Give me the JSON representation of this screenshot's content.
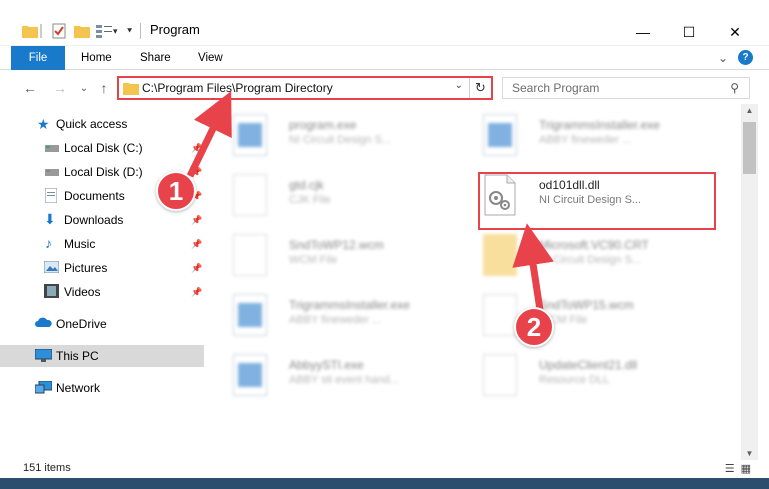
{
  "window": {
    "title": "Program",
    "minimize": "—",
    "maximize": "☐",
    "close": "✕"
  },
  "ribbon": {
    "tabs": [
      "File",
      "Home",
      "Share",
      "View"
    ],
    "expand": "⌄",
    "help": "?"
  },
  "navbar": {
    "back": "←",
    "forward": "→",
    "recent": "⌄",
    "up": "↑",
    "address": "C:\\Program Files\\Program Directory",
    "search_placeholder": "Search Program"
  },
  "sidebar": {
    "items": [
      {
        "label": "Quick access",
        "icon": "star-icon",
        "pinned": false
      },
      {
        "label": "Local Disk (C:)",
        "icon": "drive-icon",
        "pinned": true
      },
      {
        "label": "Local Disk (D:)",
        "icon": "drive-icon",
        "pinned": true
      },
      {
        "label": "Documents",
        "icon": "document-icon",
        "pinned": true
      },
      {
        "label": "Downloads",
        "icon": "download-icon",
        "pinned": true
      },
      {
        "label": "Music",
        "icon": "music-icon",
        "pinned": true
      },
      {
        "label": "Pictures",
        "icon": "pictures-icon",
        "pinned": true
      },
      {
        "label": "Videos",
        "icon": "video-icon",
        "pinned": true
      },
      {
        "label": "OneDrive",
        "icon": "cloud-icon",
        "pinned": false
      },
      {
        "label": "This PC",
        "icon": "computer-icon",
        "pinned": false
      },
      {
        "label": "Network",
        "icon": "network-icon",
        "pinned": false
      }
    ]
  },
  "files": [
    {
      "name": "program.exe",
      "type": "NI Circuit Design S..."
    },
    {
      "name": "TrigrammsInstaller.exe",
      "type": "ABBY fineweder ..."
    },
    {
      "name": "gtd.cjk",
      "type": "CJK File"
    },
    {
      "name": "od101dll.dll",
      "type": "NI Circuit Design S..."
    },
    {
      "name": "SndToWP12.wcm",
      "type": "WCM File"
    },
    {
      "name": "Microsoft.VC90.CRT",
      "type": "NI Circuit Design S..."
    },
    {
      "name": "TrigrammsInstaller.exe",
      "type": "ABBY fineweder ..."
    },
    {
      "name": "SndToWP15.wcm",
      "type": "WCM File"
    },
    {
      "name": "AbbyySTI.exe",
      "type": "ABBY sti event hand..."
    },
    {
      "name": "UpdateClient21.dll",
      "type": "Resource DLL"
    }
  ],
  "callouts": [
    "1",
    "2"
  ],
  "status": {
    "count": "151 items",
    "view_details": "☰",
    "view_tiles": "▦"
  },
  "colors": {
    "accent": "#1979ca",
    "highlight": "#e8424a"
  }
}
